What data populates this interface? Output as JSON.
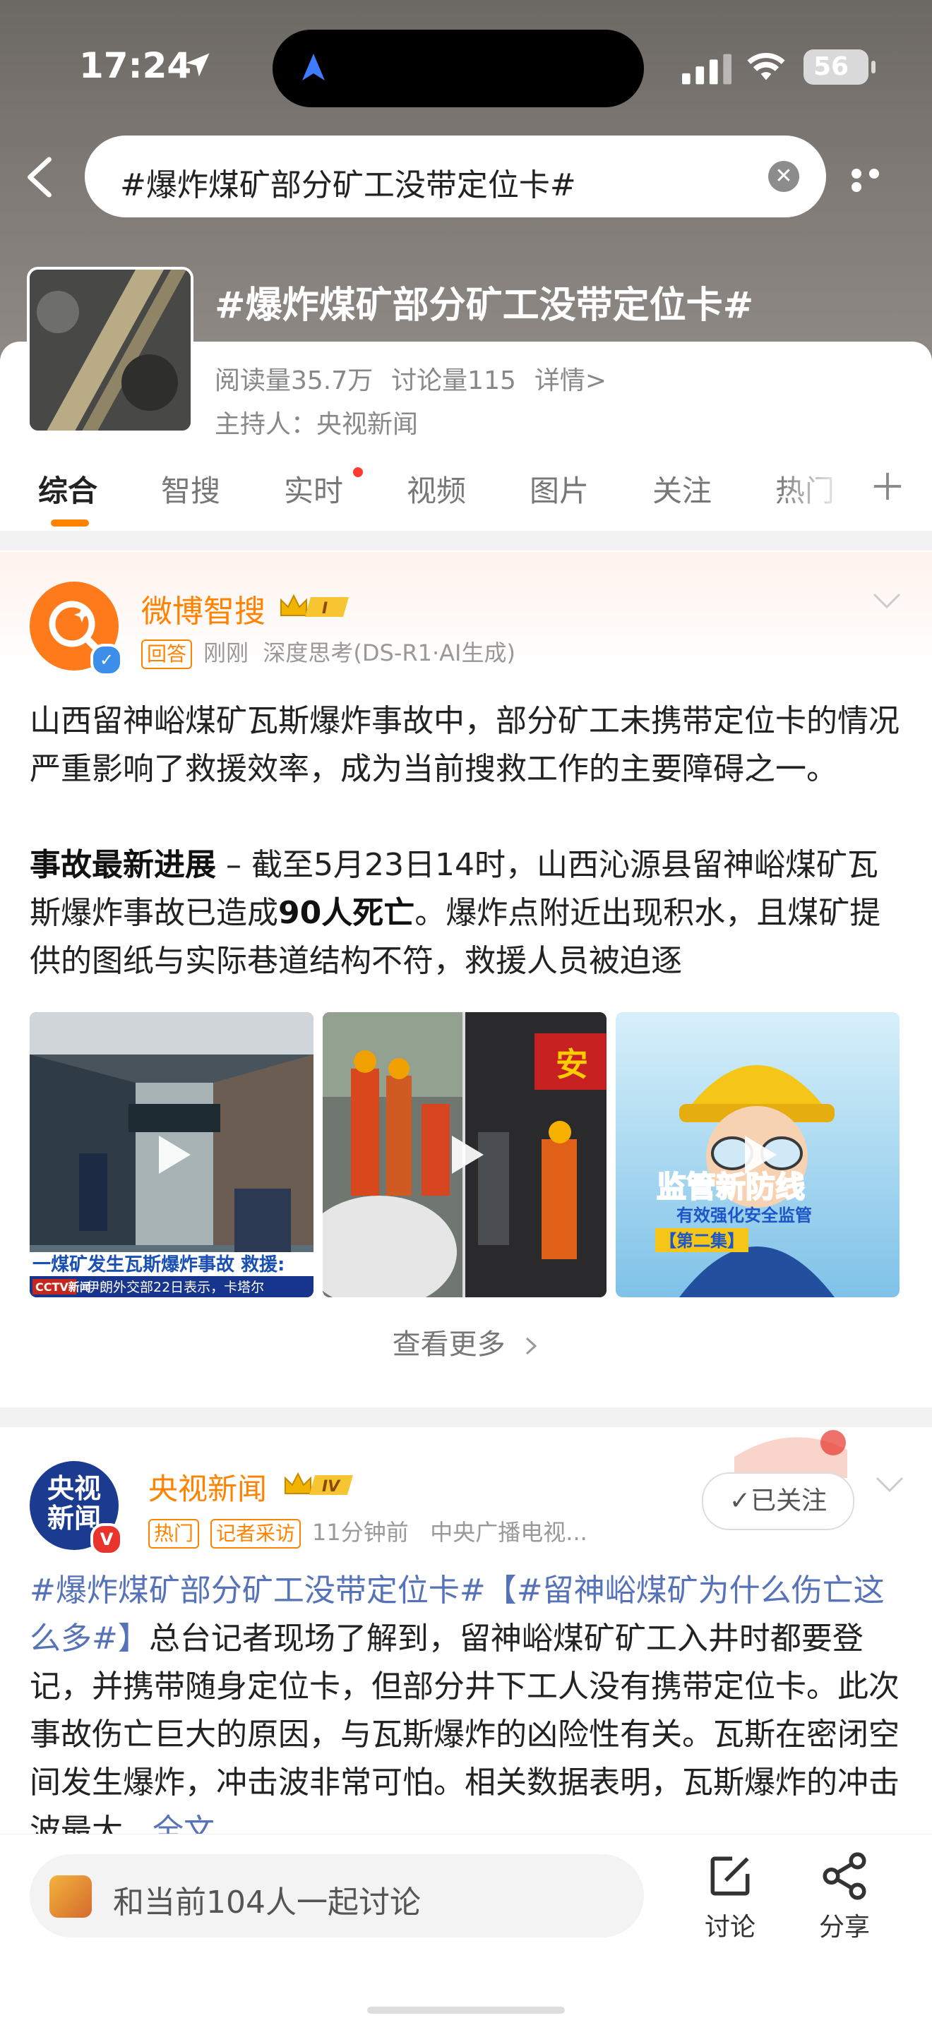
{
  "status_bar": {
    "time": "17:24",
    "battery": "56"
  },
  "search": {
    "query": "#爆炸煤矿部分矿工没带定位卡#"
  },
  "topic": {
    "title": "#爆炸煤矿部分矿工没带定位卡#",
    "reads": "阅读量35.7万",
    "discussions": "讨论量115",
    "details_link": "详情>",
    "host": "主持人：央视新闻"
  },
  "tabs": [
    "综合",
    "智搜",
    "实时",
    "视频",
    "图片",
    "关注",
    "热门"
  ],
  "ai_post": {
    "author": "微博智搜",
    "level_badge": "I",
    "tag": "回答",
    "time": "刚刚",
    "source": "深度思考(DS-R1·AI生成)",
    "paragraph1": "山西留神峪煤矿瓦斯爆炸事故中，部分矿工未携带定位卡的情况严重影响了救援效率，成为当前搜救工作的主要障碍之一。",
    "p2_heading": "事故最新进展",
    "p2_prefix": " – 截至5月23日14时，山西沁源县留神峪煤矿瓦斯爆炸事故已造成",
    "p2_bold": "90人死亡",
    "p2_rest": "。爆炸点附近出现积水，且煤矿提供的图纸与实际巷道结构不符，救援人员被迫逐",
    "media": [
      {
        "caption": "一煤矿发生瓦斯爆炸事故 救援:",
        "ticker": "伊朗外交部22日表示，卡塔尔"
      },
      {
        "caption": "",
        "ticker": ""
      },
      {
        "caption": "监管新防线",
        "subcaption": "有效强化安全监管",
        "episode": "【第二集】"
      }
    ],
    "see_more": "查看更多"
  },
  "news_post": {
    "author": "央视新闻",
    "level_badge": "IV",
    "avatar_text_1": "央视",
    "avatar_text_2": "新闻",
    "tag_hot": "热门",
    "tag_reporter": "记者采访",
    "time": "11分钟前",
    "source": "中央广播电视...",
    "follow_label": "✓已关注",
    "hashtag1": "#爆炸煤矿部分矿工没带定位卡#",
    "hashtag2": "【#留神峪煤矿为什么伤亡这么多#】",
    "body": "总台记者现场了解到，留神峪煤矿矿工入井时都要登记，并携带随身定位卡，但部分井下工人没有携带定位卡。此次事故伤亡巨大的原因，与瓦斯爆炸的凶险性有关。瓦斯在密闭空间发生爆炸，冲击波非常可怕。相关数据表明，瓦斯爆炸的冲击波最大...",
    "full_text": "全文"
  },
  "bottom_bar": {
    "discuss_placeholder": "和当前104人一起讨论",
    "discuss_label": "讨论",
    "share_label": "分享"
  },
  "colors": {
    "accent": "#ff8200",
    "link": "#5672b8",
    "verify_blue": "#3d8ee8",
    "verify_red": "#e8342c"
  }
}
